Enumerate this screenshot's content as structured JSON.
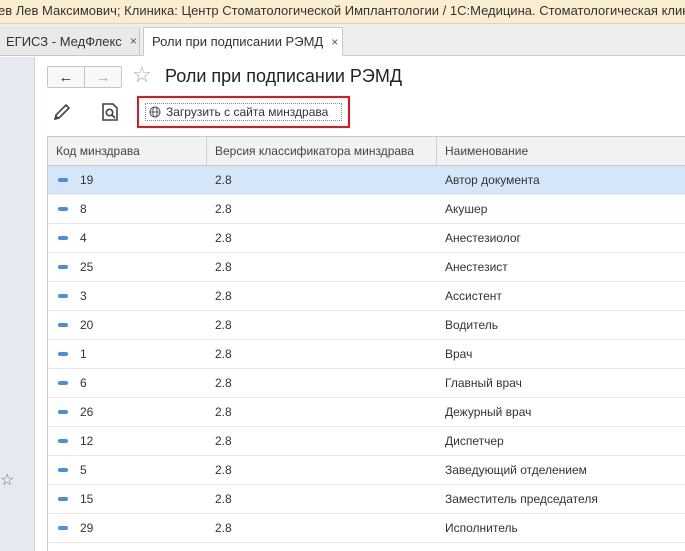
{
  "window": {
    "title": "ев Лев Максимович; Клиника: Центр Стоматологической Имплантологии / 1С:Медицина. Стоматологическая клиника"
  },
  "tabs": [
    {
      "label": "ЕГИСЗ - МедФлекс",
      "close": "×"
    },
    {
      "label": "Роли при подписании РЭМД",
      "close": "×"
    }
  ],
  "nav": {
    "back": "←",
    "forward": "→"
  },
  "page": {
    "title": "Роли при подписании РЭМД"
  },
  "toolbar": {
    "load_label": "Загрузить с сайта минздрава",
    "edit_icon": "pencil-icon",
    "search_icon": "document-search-icon"
  },
  "table": {
    "headers": [
      "Код минздрава",
      "Версия классификатора минздрава",
      "Наименование"
    ],
    "rows": [
      {
        "code": "19",
        "version": "2.8",
        "name": "Автор документа"
      },
      {
        "code": "8",
        "version": "2.8",
        "name": "Акушер"
      },
      {
        "code": "4",
        "version": "2.8",
        "name": "Анестезиолог"
      },
      {
        "code": "25",
        "version": "2.8",
        "name": "Анестезист"
      },
      {
        "code": "3",
        "version": "2.8",
        "name": "Ассистент"
      },
      {
        "code": "20",
        "version": "2.8",
        "name": "Водитель"
      },
      {
        "code": "1",
        "version": "2.8",
        "name": "Врач"
      },
      {
        "code": "6",
        "version": "2.8",
        "name": "Главный врач"
      },
      {
        "code": "26",
        "version": "2.8",
        "name": "Дежурный врач"
      },
      {
        "code": "12",
        "version": "2.8",
        "name": "Диспетчер"
      },
      {
        "code": "5",
        "version": "2.8",
        "name": "Заведующий отделением"
      },
      {
        "code": "15",
        "version": "2.8",
        "name": "Заместитель председателя"
      },
      {
        "code": "29",
        "version": "2.8",
        "name": "Исполнитель"
      }
    ]
  },
  "colors": {
    "accent": "#4a8fd8",
    "selected_row": "#d5e6f9",
    "highlight_border": "#e01a1a",
    "titlebar": "#fbeed0"
  }
}
